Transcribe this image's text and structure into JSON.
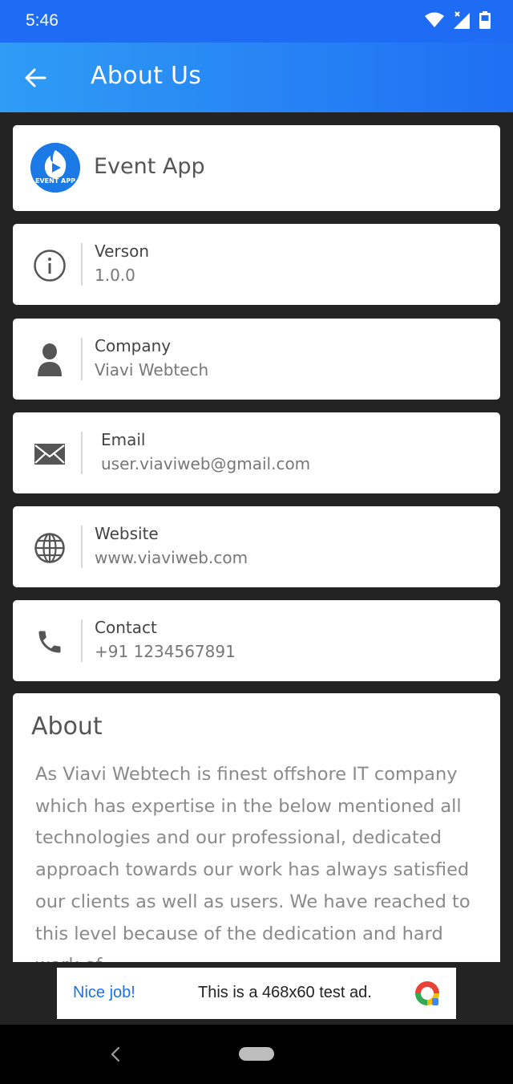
{
  "status_bar": {
    "time": "5:46",
    "icons": [
      "wifi-icon",
      "signal-icon",
      "battery-icon"
    ]
  },
  "app_bar": {
    "title": "About Us",
    "back_icon": "arrow-back-icon"
  },
  "app_card": {
    "name": "Event App",
    "logo_text": "EVENT APP"
  },
  "info": [
    {
      "label": "Verson",
      "value": "1.0.0",
      "icon": "info-icon"
    },
    {
      "label": "Company",
      "value": "Viavi Webtech",
      "icon": "person-icon"
    },
    {
      "label": "Email",
      "value": "user.viaviweb@gmail.com",
      "icon": "mail-icon"
    },
    {
      "label": "Website",
      "value": "www.viaviweb.com",
      "icon": "globe-icon"
    },
    {
      "label": "Contact",
      "value": "+91 1234567891",
      "icon": "phone-icon"
    }
  ],
  "about": {
    "title": "About",
    "text": "As Viavi Webtech is finest offshore IT company which has expertise in the below mentioned all technologies and our professional, dedicated approach towards our work has always satisfied our clients as well as users. We have reached to this level because of the dedication and hard work of"
  },
  "ad": {
    "headline": "Nice job!",
    "text": "This is a 468x60 test ad."
  },
  "colors": {
    "primary": "#1e6cf4",
    "gradient_start": "#2f9cf5",
    "background": "#232323"
  }
}
